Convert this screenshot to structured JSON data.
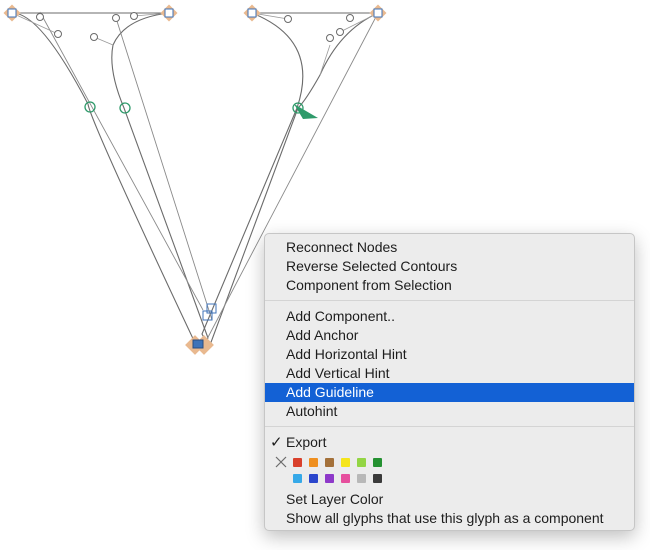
{
  "menu": {
    "groups": [
      {
        "items": [
          {
            "label": "Reconnect Nodes",
            "name": "menu-item-reconnect-nodes"
          },
          {
            "label": "Reverse Selected Contours",
            "name": "menu-item-reverse-selected-contours"
          },
          {
            "label": "Component from Selection",
            "name": "menu-item-component-from-selection"
          }
        ]
      },
      {
        "items": [
          {
            "label": "Add Component..",
            "name": "menu-item-add-component"
          },
          {
            "label": "Add Anchor",
            "name": "menu-item-add-anchor"
          },
          {
            "label": "Add Horizontal Hint",
            "name": "menu-item-add-horizontal-hint"
          },
          {
            "label": "Add Vertical Hint",
            "name": "menu-item-add-vertical-hint"
          },
          {
            "label": "Add Guideline",
            "name": "menu-item-add-guideline",
            "highlighted": true
          },
          {
            "label": "Autohint",
            "name": "menu-item-autohint"
          }
        ]
      },
      {
        "items": [
          {
            "label": "Export",
            "name": "menu-item-export",
            "checked": true
          }
        ]
      }
    ],
    "check_glyph": "✓",
    "color_row_1": [
      "#d9402b",
      "#ef8f1f",
      "#a4713a",
      "#f5e51b",
      "#93d544",
      "#249131"
    ],
    "color_row_2": [
      "#36a9e8",
      "#2b46cc",
      "#8e39c9",
      "#e64f9d",
      "#b8b8b8",
      "#3a3a3a"
    ],
    "set_layer_color": "Set Layer Color",
    "show_all_glyphs": "Show all glyphs that use this glyph as a component",
    "highlight_color": "#1361d5"
  },
  "canvas": {
    "outline_color": "#6b6b6b",
    "node_highlight_color": "#e9b98f",
    "smooth_node_color": "#2e9a6a",
    "anchor_color": "#2e9a6a",
    "corner_node_color": "#3f73b8"
  }
}
